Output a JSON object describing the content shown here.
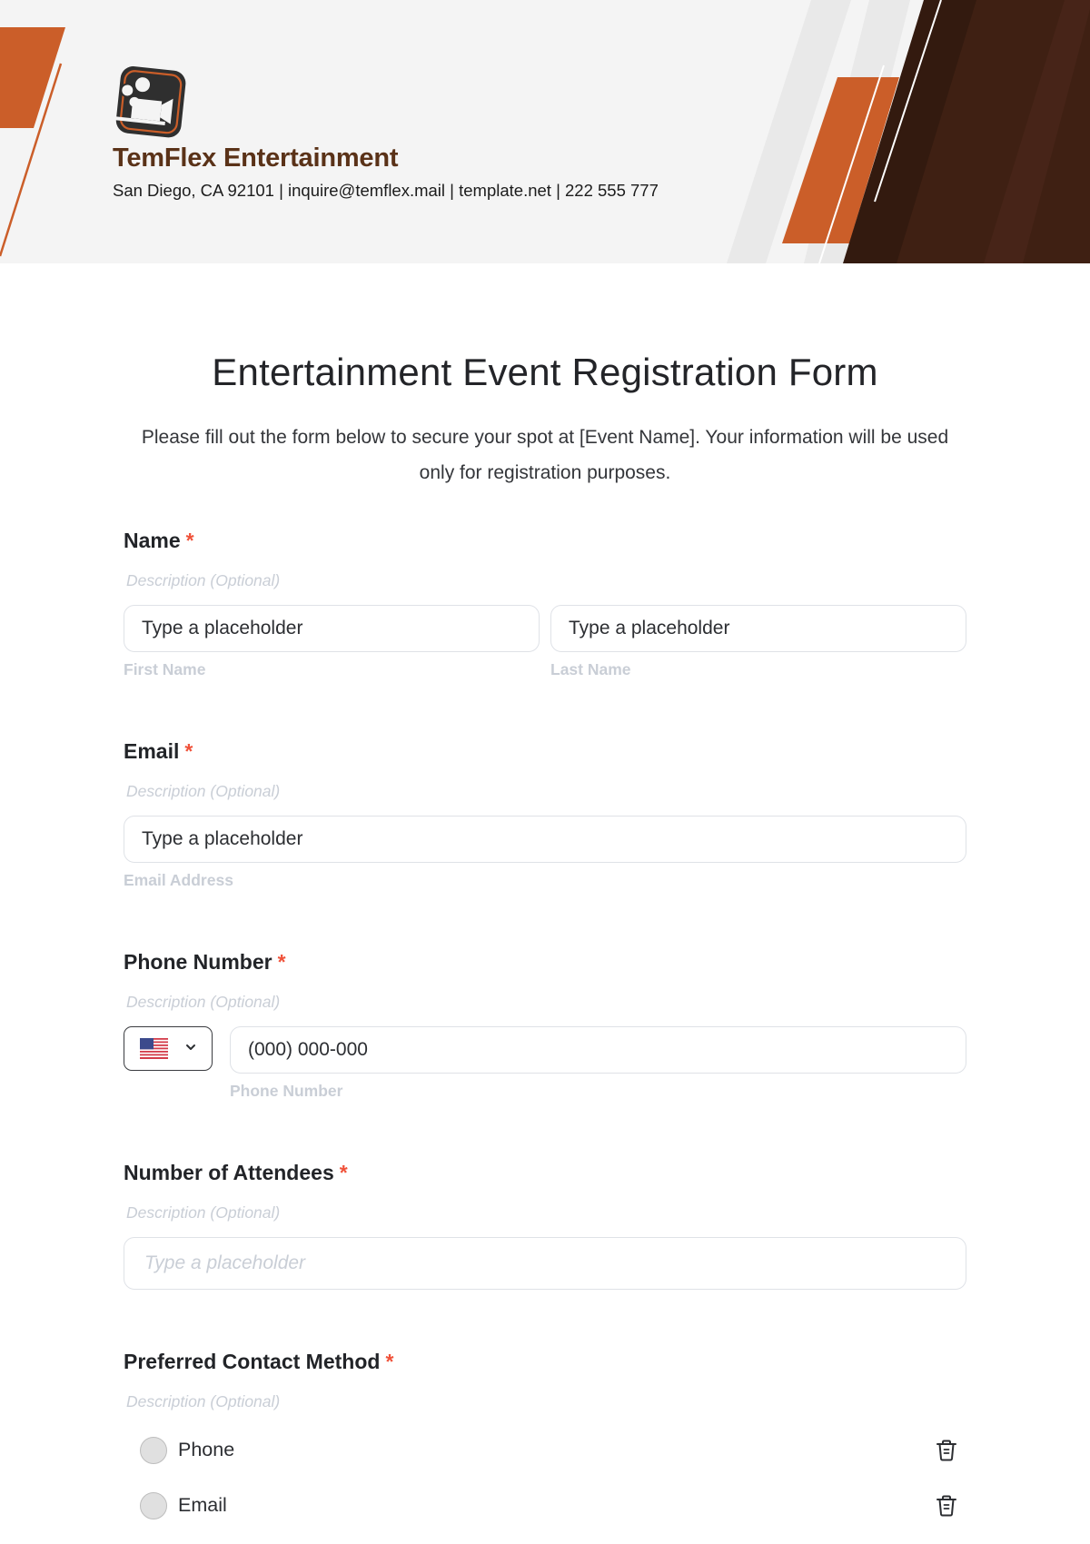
{
  "company": {
    "name": "TemFlex Entertainment",
    "contact": "San Diego, CA 92101 | inquire@temflex.mail | template.net | 222 555 777",
    "logo_icon": "film-camera-icon"
  },
  "colors": {
    "accent_orange": "#cb5e29",
    "brand_brown": "#5a3218",
    "dark_brown": "#331a0f",
    "required_red": "#f0523a",
    "header_bg": "#f4f4f4"
  },
  "form": {
    "title": "Entertainment Event Registration Form",
    "intro": "Please fill out the form below to secure your spot at [Event Name]. Your information will be used only for registration purposes."
  },
  "fields": {
    "name": {
      "label": "Name",
      "required_mark": "*",
      "description": "Description (Optional)",
      "first": {
        "value": "Type a placeholder",
        "helper": "First Name"
      },
      "last": {
        "value": "Type a placeholder",
        "helper": "Last Name"
      }
    },
    "email": {
      "label": "Email",
      "required_mark": "*",
      "description": "Description (Optional)",
      "value": "Type a placeholder",
      "helper": "Email Address"
    },
    "phone": {
      "label": "Phone Number",
      "required_mark": "*",
      "description": "Description (Optional)",
      "country": {
        "flag_icon": "us-flag-icon",
        "selected": "US"
      },
      "value": "(000) 000-000",
      "helper": "Phone Number"
    },
    "attendees": {
      "label": "Number of Attendees",
      "required_mark": "*",
      "description": "Description (Optional)",
      "placeholder": "Type a placeholder"
    },
    "contact_method": {
      "label": "Preferred Contact Method",
      "required_mark": "*",
      "description": "Description (Optional)",
      "options": [
        {
          "label": "Phone",
          "selected": false
        },
        {
          "label": "Email",
          "selected": false
        }
      ]
    }
  }
}
